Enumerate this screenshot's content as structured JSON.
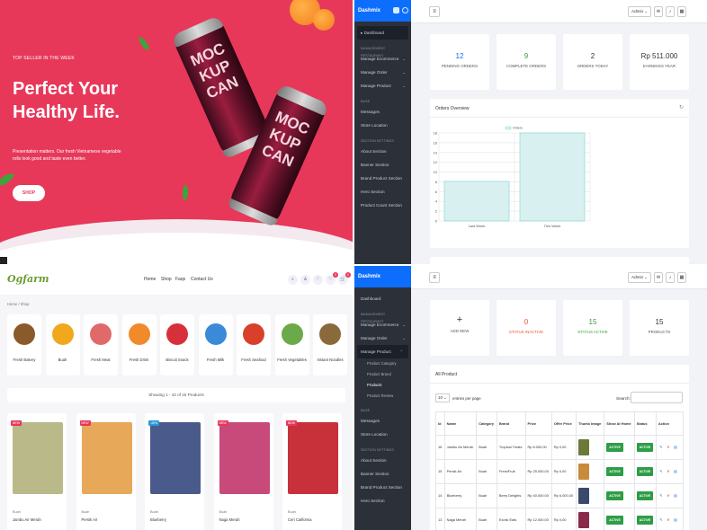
{
  "hero": {
    "eyebrow": "TOP SELLER IN THE WEEK",
    "title": "Perfect Your Healthy Life.",
    "description": "Presentation matters. Our fresh Vietnamese vegetable rolls look good and taste even better.",
    "button": "SHOP",
    "can_text": "MOC KUP CAN"
  },
  "admin": {
    "brand": "Dashmix",
    "user_label": "Admin",
    "sidebar": {
      "dashboard": "Dashboard",
      "section_management": "MANAGEMENT RESTAURANT",
      "manage_ecommerce": "Manage Ecommerce",
      "manage_order": "Manage Order",
      "manage_product": "Manage Product",
      "section_base": "BASE",
      "messages": "Messages",
      "store_location": "Store Location",
      "section_settings": "SECTION SETTINGS",
      "about_section": "About Section",
      "banner_section": "Banner Section",
      "brand_product_section": "Brand Product Section",
      "hero_section": "Hero Section",
      "product_count_section": "Product Count Section",
      "sub_product_category": "Product Category",
      "sub_product_brand": "Product Brand",
      "sub_products": "Products",
      "sub_product_review": "Product Review"
    },
    "dashboard_stats": [
      {
        "value": "12",
        "label": "PENDING ORDERS",
        "color": "#0d6efd"
      },
      {
        "value": "9",
        "label": "COMPLETE ORDERS",
        "color": "#3a9d3a"
      },
      {
        "value": "2",
        "label": "ORDERS TODAY",
        "color": "#222222"
      },
      {
        "value": "Rp 511.000",
        "label": "EARNINGS YEAR",
        "color": "#222222"
      }
    ],
    "orders_overview": "Orders Overview",
    "product_stats": [
      {
        "value": "+",
        "label": "ADD NEW",
        "color": "#222222"
      },
      {
        "value": "0",
        "label": "STATUS INACTIVE",
        "color": "#e8542c"
      },
      {
        "value": "15",
        "label": "STATUS ACTIVE",
        "color": "#3a9d3a"
      },
      {
        "value": "15",
        "label": "PRODUCTS",
        "color": "#222222"
      }
    ],
    "all_product": "All Product",
    "entries_select": "10",
    "entries_label": "entries per page",
    "search_label": "Search:",
    "table": {
      "headers": [
        "Id",
        "Name",
        "Category",
        "Brand",
        "Price",
        "Offer Price",
        "Thumb Image",
        "Show At Home",
        "Status",
        "Action"
      ],
      "rows": [
        {
          "id": "16",
          "name": "Jambu Air Merah",
          "category": "Buah",
          "brand": "Tropical Treats",
          "price": "Rp 8.000,00",
          "offer": "Rp 0,00",
          "home": "ACTIVE",
          "status": "ACTIVE",
          "thumb": "#6b7a3a"
        },
        {
          "id": "15",
          "name": "Persik Air",
          "category": "Buah",
          "brand": "FreshFruit",
          "price": "Rp 25.000,00",
          "offer": "Rp 0,00",
          "home": "ACTIVE",
          "status": "ACTIVE",
          "thumb": "#c98a3a"
        },
        {
          "id": "14",
          "name": "Blueberry",
          "category": "Buah",
          "brand": "Berry Delights",
          "price": "Rp 40.000,00",
          "offer": "Rp 6.000,00",
          "home": "ACTIVE",
          "status": "ACTIVE",
          "thumb": "#3a4a6a"
        },
        {
          "id": "13",
          "name": "Naga Merah",
          "category": "Buah",
          "brand": "Exotic Eats",
          "price": "Rp 12.000,00",
          "offer": "Rp 0,00",
          "home": "ACTIVE",
          "status": "ACTIVE",
          "thumb": "#8a2a4a"
        }
      ]
    }
  },
  "chart_data": {
    "type": "bar",
    "categories": [
      "Last Week",
      "This Week"
    ],
    "series": [
      {
        "name": "Orders",
        "values": [
          8.1,
          18
        ]
      }
    ],
    "ylim": [
      0,
      18
    ],
    "yticks": [
      0,
      2,
      4,
      6,
      8,
      10,
      12,
      14,
      16,
      18
    ],
    "grid": true,
    "legend": "top"
  },
  "shop": {
    "logo": "Ogfarm",
    "nav": [
      "Home",
      "Shop",
      "Faqs",
      "Contact Us"
    ],
    "cart_badge": "0",
    "wish_badge": "0",
    "breadcrumb": "Home / Shop",
    "categories": [
      {
        "name": "Fresh Bakery",
        "color": "#8a5a2a"
      },
      {
        "name": "Buah",
        "color": "#f2a81c"
      },
      {
        "name": "Fresh Meat",
        "color": "#e06a6a"
      },
      {
        "name": "Fresh Drink",
        "color": "#f08a2a"
      },
      {
        "name": "Biscuit Snack",
        "color": "#d8303a"
      },
      {
        "name": "Fresh Milk",
        "color": "#3a8ad8"
      },
      {
        "name": "Fresh Seafood",
        "color": "#d8402a"
      },
      {
        "name": "Fresh Vegetables",
        "color": "#6aaa4a"
      },
      {
        "name": "Instant Noodles",
        "color": "#8a6a3a"
      }
    ],
    "showing": "Showing 1 - 10 of 15 Products",
    "products": [
      {
        "tag": "NEW",
        "tag_color": "#e7385a",
        "category": "Buah",
        "name": "Jambu Air Merah",
        "color": "#b9b98a"
      },
      {
        "tag": "NEW",
        "tag_color": "#e7385a",
        "category": "Buah",
        "name": "Persik Air",
        "color": "#e8a85a"
      },
      {
        "tag": "-40%",
        "tag_color": "#2a9ad8",
        "category": "Buah",
        "name": "Blueberry",
        "color": "#4a5a8a"
      },
      {
        "tag": "NEW",
        "tag_color": "#e7385a",
        "category": "Buah",
        "name": "Naga Merah",
        "color": "#c84a7a"
      },
      {
        "tag": "NEW",
        "tag_color": "#e7385a",
        "category": "Buah",
        "name": "Ceri California",
        "color": "#c8303a"
      }
    ]
  }
}
